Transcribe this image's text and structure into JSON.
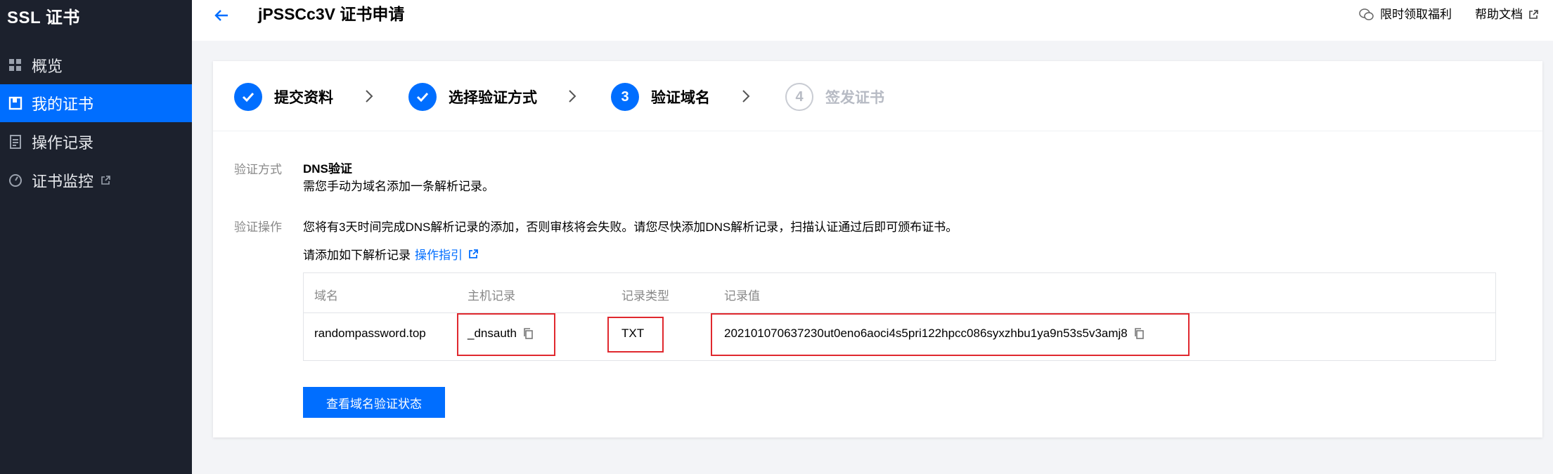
{
  "app": {
    "brand": "SSL 证书",
    "nav": [
      {
        "label": "概览",
        "icon": "grid-icon",
        "active": false
      },
      {
        "label": "我的证书",
        "icon": "certificate-icon",
        "active": true
      },
      {
        "label": "操作记录",
        "icon": "log-icon",
        "active": false
      },
      {
        "label": "证书监控",
        "icon": "monitor-icon",
        "active": false,
        "external": true
      }
    ]
  },
  "header": {
    "title": "jPSSCc3V 证书申请",
    "links": {
      "welfare": "限时领取福利",
      "help": "帮助文档"
    }
  },
  "steps": [
    {
      "label": "提交资料",
      "state": "done"
    },
    {
      "label": "选择验证方式",
      "state": "done"
    },
    {
      "label": "验证域名",
      "state": "current",
      "number": "3"
    },
    {
      "label": "签发证书",
      "state": "todo",
      "number": "4"
    }
  ],
  "verify_method": {
    "label": "验证方式",
    "value": "DNS验证",
    "desc": "需您手动为域名添加一条解析记录。"
  },
  "verify_action": {
    "label": "验证操作",
    "notice": "您将有3天时间完成DNS解析记录的添加，否则审核将会失败。请您尽快添加DNS解析记录，扫描认证通过后即可颁布证书。",
    "add_hint": "请添加如下解析记录",
    "guide_link": "操作指引"
  },
  "table": {
    "headers": [
      "域名",
      "主机记录",
      "记录类型",
      "记录值"
    ],
    "row": {
      "domain": "randompassword.top",
      "host": "_dnsauth",
      "type": "TXT",
      "value": "202101070637230ut0eno6aoci4s5pri122hpcc086syxzhbu1ya9n53s5v3amj8"
    }
  },
  "buttons": {
    "check_status": "查看域名验证状态"
  },
  "colors": {
    "accent": "#006eff",
    "sidebar_bg": "#1c212d",
    "highlight": "#e0282e"
  }
}
